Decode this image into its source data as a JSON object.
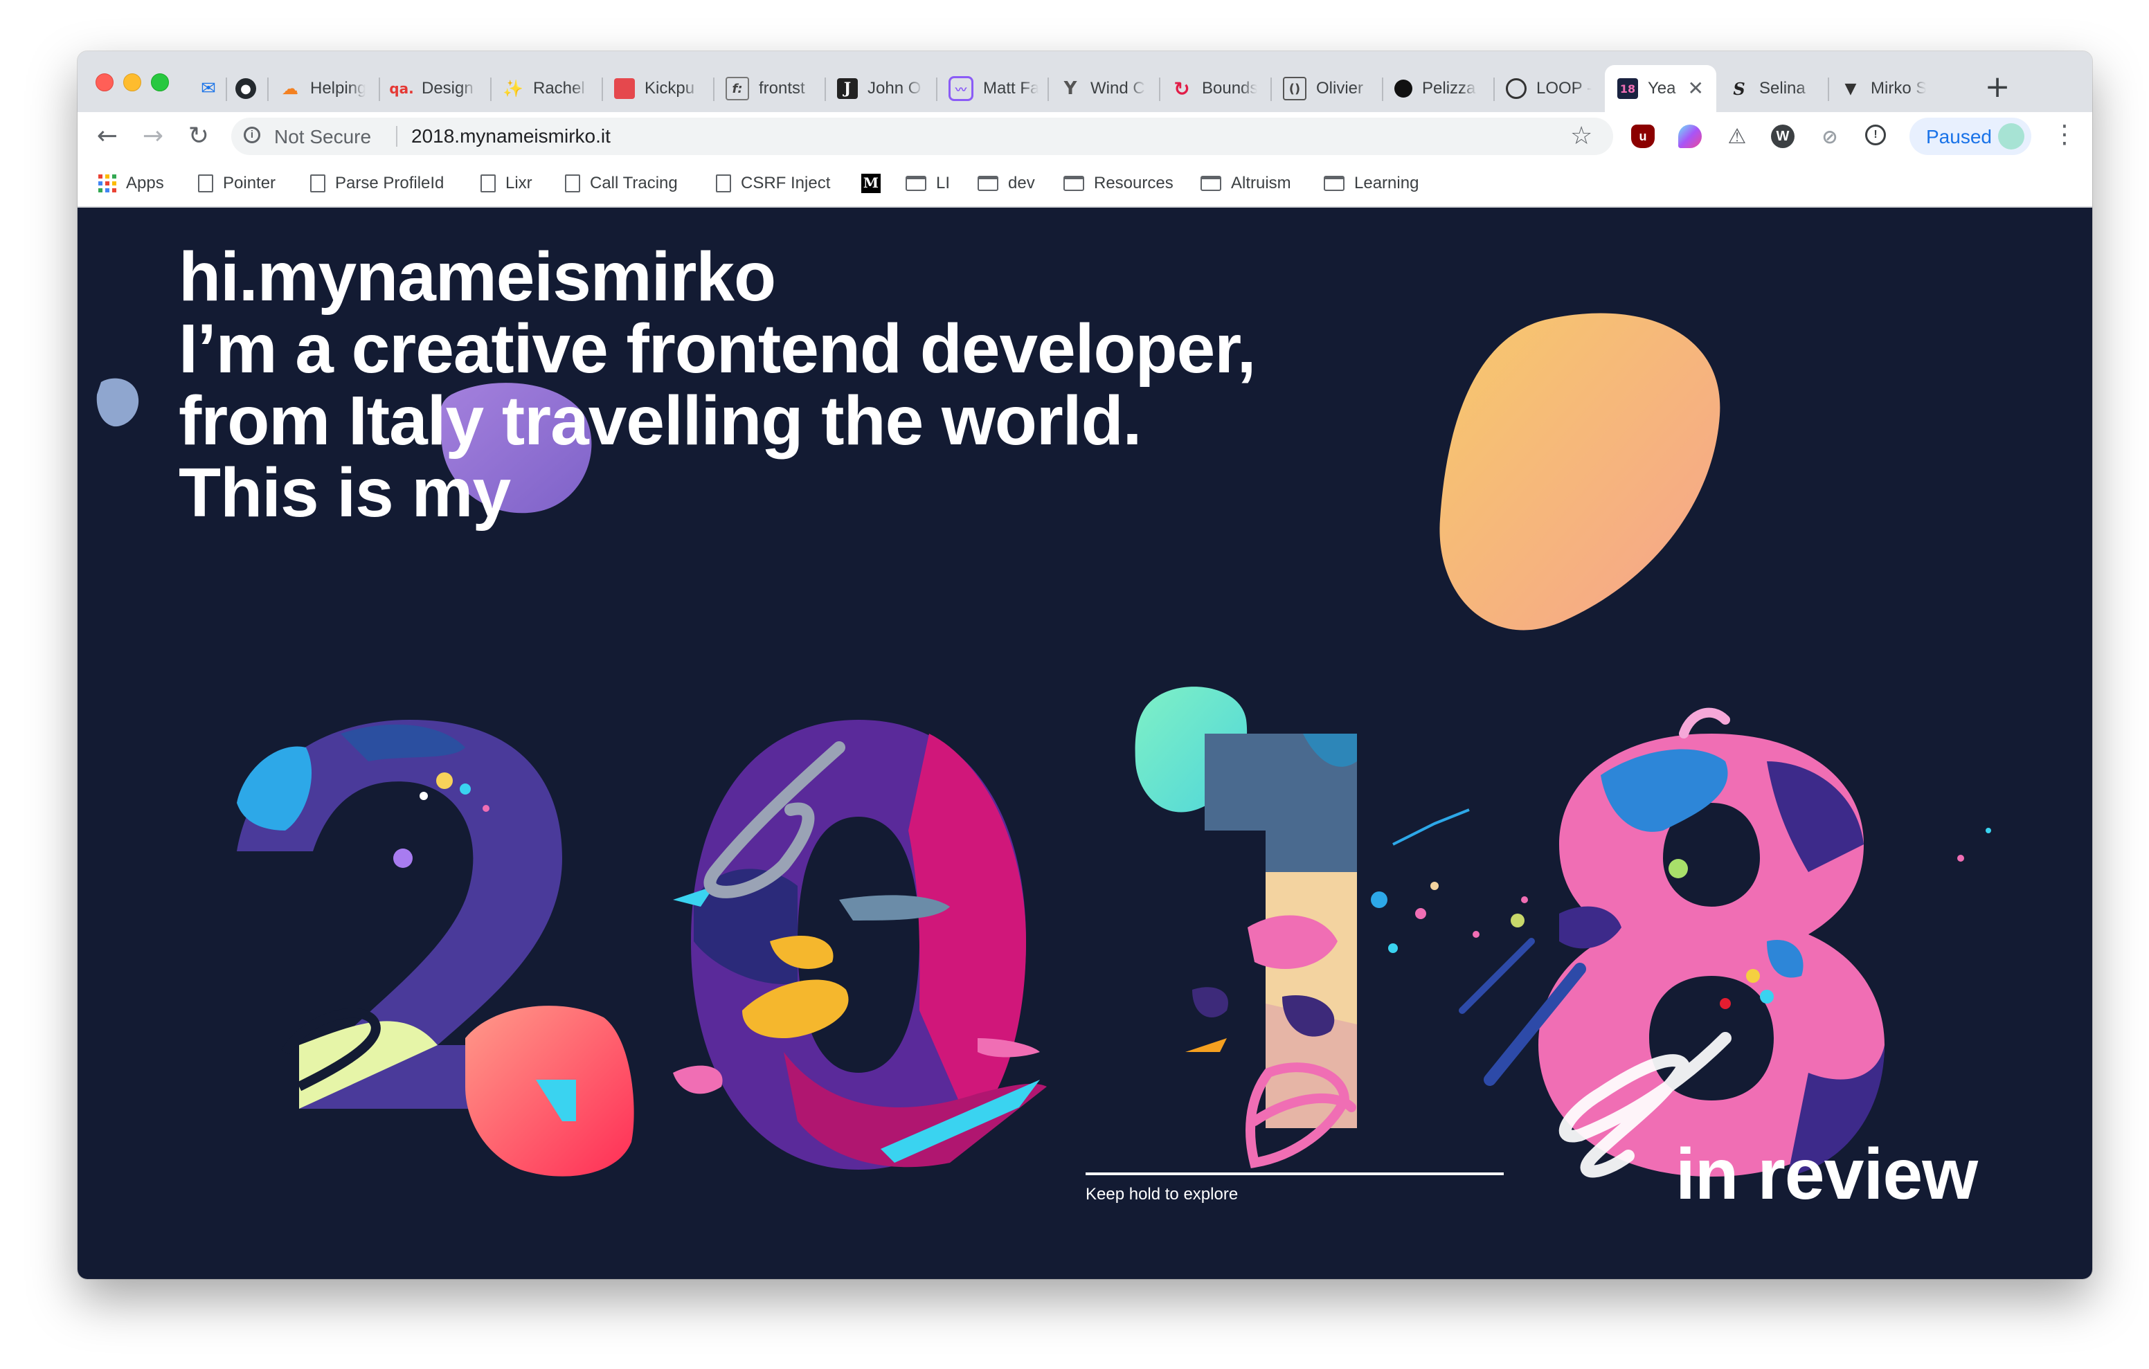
{
  "browser": {
    "tabs": [
      {
        "title": "",
        "icon": "mail-icon"
      },
      {
        "title": "",
        "icon": "github-icon"
      },
      {
        "title": "Helping",
        "icon": "cloudflare-icon"
      },
      {
        "title": "Design",
        "icon": "qa-icon"
      },
      {
        "title": "Rachel",
        "icon": "sparkle-icon"
      },
      {
        "title": "Kickpu",
        "icon": "red-square-icon"
      },
      {
        "title": "frontst",
        "icon": "function-icon"
      },
      {
        "title": "John O",
        "icon": "j-icon"
      },
      {
        "title": "Matt Fa",
        "icon": "chart-icon"
      },
      {
        "title": "Wind C",
        "icon": "windmill-icon"
      },
      {
        "title": "Bounds",
        "icon": "bounds-icon"
      },
      {
        "title": "Olivier",
        "icon": "o-icon"
      },
      {
        "title": "Pelizza",
        "icon": "black-dot-icon"
      },
      {
        "title": "LOOP -",
        "icon": "loop-icon"
      },
      {
        "title": "Yea",
        "icon": "site-icon",
        "active": true
      },
      {
        "title": "Selina",
        "icon": "s-icon"
      },
      {
        "title": "Mirko S",
        "icon": "triangle-icon"
      }
    ],
    "new_tab": "+",
    "close_glyph": "✕",
    "address": {
      "security": "Not Secure",
      "url": "2018.mynameismirko.it"
    },
    "profile": {
      "label": "Paused"
    },
    "bookmarks": [
      {
        "label": "Apps",
        "icon": "apps-grid-icon"
      },
      {
        "label": "Pointer",
        "icon": "page-icon"
      },
      {
        "label": "Parse ProfileId",
        "icon": "page-icon"
      },
      {
        "label": "Lixr",
        "icon": "page-icon"
      },
      {
        "label": "Call Tracing",
        "icon": "page-icon"
      },
      {
        "label": "CSRF Inject",
        "icon": "page-icon"
      },
      {
        "label": "",
        "icon": "medium-icon"
      },
      {
        "label": "LI",
        "icon": "folder-icon"
      },
      {
        "label": "dev",
        "icon": "folder-icon"
      },
      {
        "label": "Resources",
        "icon": "folder-icon"
      },
      {
        "label": "Altruism",
        "icon": "folder-icon"
      },
      {
        "label": "Learning",
        "icon": "folder-icon"
      }
    ]
  },
  "page": {
    "intro_lines": [
      "hi.mynameismirko",
      "I’m a creative frontend developer,",
      "from Italy travelling the world.",
      "This is my"
    ],
    "year_digits": [
      "2",
      "0",
      "1",
      "8"
    ],
    "hint": "Keep hold to explore",
    "tagline": "in review",
    "colors": {
      "background": "#131b33",
      "text": "#ffffff",
      "accent_orange": "#f6b26b",
      "accent_pink": "#f06eb4",
      "accent_purple": "#4a2a8a",
      "accent_magenta": "#d0177a",
      "accent_cyan": "#3ad3f0"
    }
  }
}
